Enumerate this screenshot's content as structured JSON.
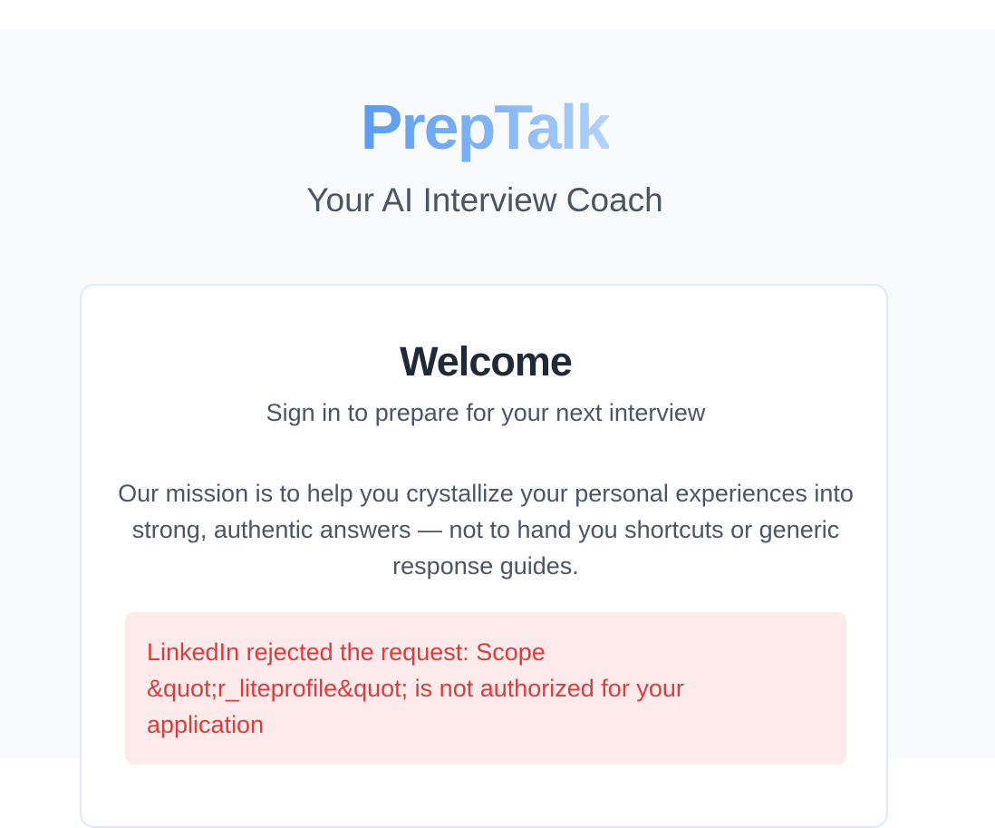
{
  "brand": {
    "name": "PrepTalk",
    "tagline": "Your AI Interview Coach"
  },
  "card": {
    "title": "Welcome",
    "subtitle": "Sign in to prepare for your next interview",
    "mission": "Our mission is to help you crystallize your personal experiences into strong, authentic answers — not to hand you shortcuts or generic response guides."
  },
  "error": {
    "message": "LinkedIn rejected the request: Scope &quot;r_liteprofile&quot; is not authorized for your application"
  },
  "colors": {
    "brand_gradient_start": "#5a9cef",
    "brand_gradient_end": "#b3d3fb",
    "error_text": "#dc3c3c",
    "error_background": "#fdeaea",
    "card_border": "#dbeafe",
    "page_background": "#f8fafc"
  }
}
